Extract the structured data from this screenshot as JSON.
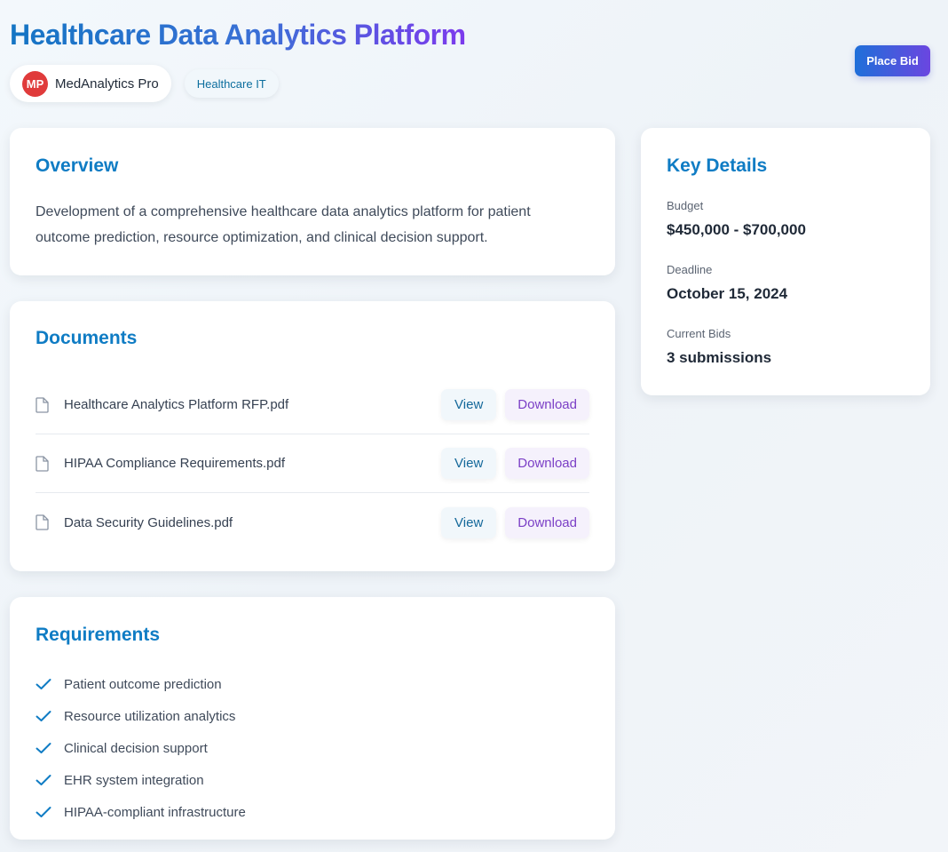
{
  "header": {
    "title": "Healthcare Data Analytics Platform",
    "org": {
      "initials": "MP",
      "name": "MedAnalytics Pro"
    },
    "tag": "Healthcare IT",
    "bid_label": "Place Bid"
  },
  "overview": {
    "heading": "Overview",
    "text": "Development of a comprehensive healthcare data analytics platform for patient outcome prediction, resource optimization, and clinical decision support."
  },
  "documents": {
    "heading": "Documents",
    "view_label": "View",
    "download_label": "Download",
    "items": [
      {
        "name": "Healthcare Analytics Platform RFP.pdf"
      },
      {
        "name": "HIPAA Compliance Requirements.pdf"
      },
      {
        "name": "Data Security Guidelines.pdf"
      }
    ]
  },
  "requirements": {
    "heading": "Requirements",
    "items": [
      "Patient outcome prediction",
      "Resource utilization analytics",
      "Clinical decision support",
      "EHR system integration",
      "HIPAA-compliant infrastructure"
    ]
  },
  "details": {
    "heading": "Key Details",
    "budget_label": "Budget",
    "budget_value": "$450,000 - $700,000",
    "deadline_label": "Deadline",
    "deadline_value": "October 15, 2024",
    "bids_label": "Current Bids",
    "bids_value": "3 submissions"
  },
  "colors": {
    "accent_blue": "#0f7cc4",
    "accent_purple": "#7c3aed",
    "avatar_red": "#e03b3b"
  },
  "icons": [
    "file-icon",
    "check-icon"
  ]
}
